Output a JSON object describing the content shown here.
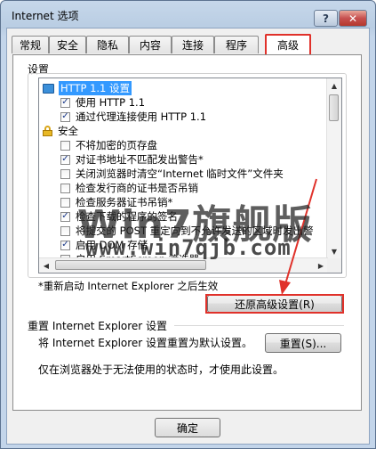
{
  "window": {
    "title": "Internet 选项",
    "help_label": "?",
    "close_label": "✕"
  },
  "tabs": [
    {
      "label": "常规",
      "active": false
    },
    {
      "label": "安全",
      "active": false
    },
    {
      "label": "隐私",
      "active": false
    },
    {
      "label": "内容",
      "active": false
    },
    {
      "label": "连接",
      "active": false
    },
    {
      "label": "程序",
      "active": false
    },
    {
      "label": "高级",
      "active": true
    }
  ],
  "settings": {
    "group_label": "设置",
    "items": [
      {
        "type": "folder",
        "label": "HTTP 1.1 设置",
        "selected": true
      },
      {
        "type": "checkbox",
        "label": "使用 HTTP 1.1",
        "checked": true
      },
      {
        "type": "checkbox",
        "label": "通过代理连接使用 HTTP 1.1",
        "checked": true
      },
      {
        "type": "lock",
        "label": "安全"
      },
      {
        "type": "checkbox",
        "label": "不将加密的页存盘",
        "checked": false
      },
      {
        "type": "checkbox",
        "label": "对证书地址不匹配发出警告*",
        "checked": true
      },
      {
        "type": "checkbox",
        "label": "关闭浏览器时清空“Internet 临时文件”文件夹",
        "checked": false
      },
      {
        "type": "checkbox",
        "label": "检查发行商的证书是否吊销",
        "checked": false
      },
      {
        "type": "checkbox",
        "label": "检查服务器证书吊销*",
        "checked": false
      },
      {
        "type": "checkbox",
        "label": "检查下载的程序的签名",
        "checked": true
      },
      {
        "type": "checkbox",
        "label": "将提交的 POST 重定向到不允许发送的区域时发出警",
        "checked": false
      },
      {
        "type": "checkbox",
        "label": "启用 DOM 存储",
        "checked": true
      },
      {
        "type": "checkbox",
        "label": "启用 SmartScreen 筛选器",
        "checked": false
      }
    ],
    "restart_note": "*重新启动 Internet Explorer 之后生效",
    "restore_button": "还原高级设置(R)"
  },
  "reset": {
    "group_label": "重置 Internet Explorer 设置",
    "description": "将 Internet Explorer 设置重置为默认设置。",
    "reset_button": "重置(S)...",
    "note": "仅在浏览器处于无法使用的状态时，才使用此设置。"
  },
  "footer": {
    "ok_label": "确定"
  },
  "watermark": {
    "brand": "Win7旗舰版",
    "url": "www.win7qjb.com"
  },
  "colors": {
    "highlight": "#e0312a",
    "selection": "#3399ff"
  }
}
